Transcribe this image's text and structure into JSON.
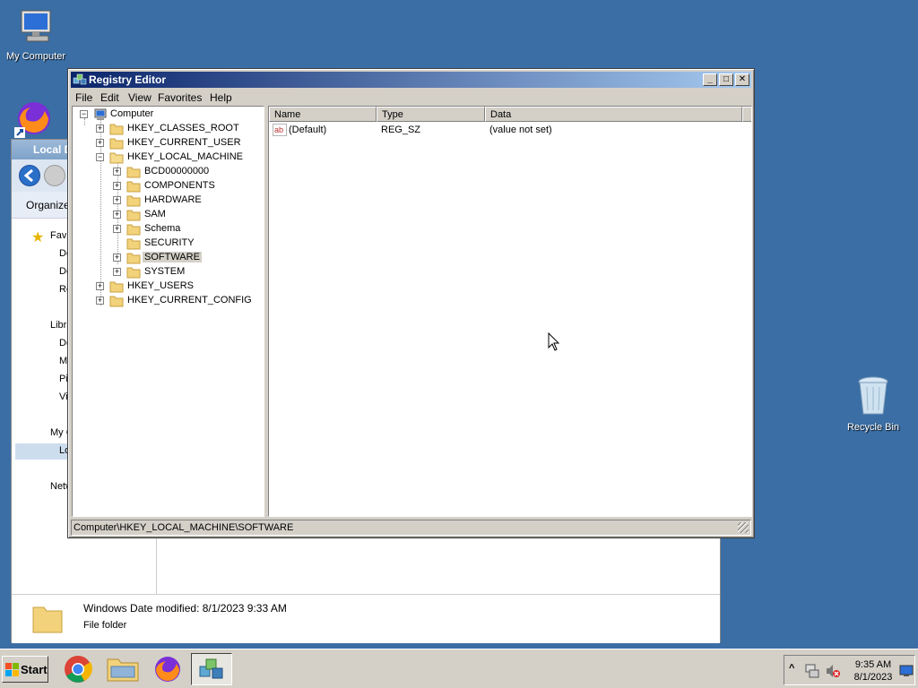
{
  "desktop": {
    "my_computer": "My Computer",
    "recycle_bin": "Recycle Bin",
    "background": "#3a6ea5"
  },
  "explorer": {
    "title": "Local D",
    "organize": "Organize",
    "nav_items": [
      "Fav",
      "De",
      "Do",
      "Re",
      "Libra",
      "Do",
      "Mu",
      "Pi",
      "Vi",
      "My C",
      "Lo",
      "Netw"
    ],
    "item_name": "Windows",
    "date_modified_label": "Date modified:",
    "date_modified": "8/1/2023 9:33 AM",
    "item_type": "File folder"
  },
  "regedit": {
    "title": "Registry Editor",
    "menu": [
      "File",
      "Edit",
      "View",
      "Favorites",
      "Help"
    ],
    "tree": {
      "root": "Computer",
      "hives": [
        "HKEY_CLASSES_ROOT",
        "HKEY_CURRENT_USER",
        "HKEY_LOCAL_MACHINE",
        "HKEY_USERS",
        "HKEY_CURRENT_CONFIG"
      ],
      "hklm_children": [
        "BCD00000000",
        "COMPONENTS",
        "HARDWARE",
        "SAM",
        "Schema",
        "SECURITY",
        "SOFTWARE",
        "SYSTEM"
      ],
      "selected": "SOFTWARE"
    },
    "columns": [
      "Name",
      "Type",
      "Data"
    ],
    "values": [
      {
        "name": "(Default)",
        "type": "REG_SZ",
        "data": "(value not set)"
      }
    ],
    "status": "Computer\\HKEY_LOCAL_MACHINE\\SOFTWARE"
  },
  "taskbar": {
    "start": "Start",
    "time": "9:35 AM",
    "date": "8/1/2023",
    "tray_arrow": "^"
  }
}
